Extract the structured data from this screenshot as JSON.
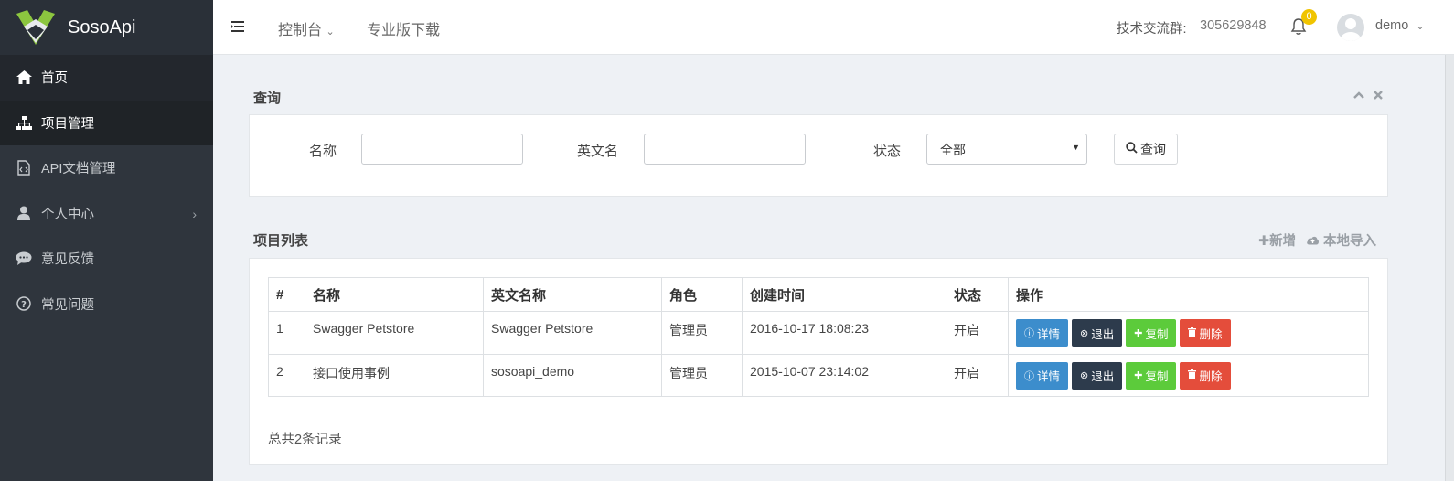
{
  "app": {
    "name": "SosoApi"
  },
  "sidebar": {
    "items": [
      {
        "label": "首页",
        "icon": "home-icon"
      },
      {
        "label": "项目管理",
        "icon": "sitemap-icon"
      },
      {
        "label": "API文档管理",
        "icon": "file-code-icon"
      },
      {
        "label": "个人中心",
        "icon": "user-icon"
      },
      {
        "label": "意见反馈",
        "icon": "comments-icon"
      },
      {
        "label": "常见问题",
        "icon": "question-circle-icon"
      }
    ]
  },
  "topbar": {
    "console": "控制台",
    "download": "专业版下载",
    "group_label": "技术交流群:",
    "group_number": "305629848",
    "notifications": "0",
    "username": "demo"
  },
  "query": {
    "title": "查询",
    "name_label": "名称",
    "name_value": "",
    "en_name_label": "英文名",
    "en_name_value": "",
    "status_label": "状态",
    "status_value": "全部",
    "button": "查询"
  },
  "list": {
    "title": "项目列表",
    "add": "新增",
    "import": "本地导入",
    "columns": [
      "#",
      "名称",
      "英文名称",
      "角色",
      "创建时间",
      "状态",
      "操作"
    ],
    "rows": [
      {
        "id": "1",
        "name": "Swagger Petstore",
        "en_name": "Swagger Petstore",
        "role": "管理员",
        "created": "2016-10-17 18:08:23",
        "status": "开启"
      },
      {
        "id": "2",
        "name": "接口使用事例",
        "en_name": "sosoapi_demo",
        "role": "管理员",
        "created": "2015-10-07 23:14:02",
        "status": "开启"
      }
    ],
    "actions": {
      "detail": "详情",
      "quit": "退出",
      "copy": "复制",
      "delete": "删除"
    },
    "total": "总共2条记录"
  },
  "colors": {
    "sidebar": "#2f353d",
    "detail": "#3c8dcc",
    "quit": "#2d3b4c",
    "copy": "#5ccb3b",
    "delete": "#e44d3b",
    "badge": "#f0c400"
  }
}
